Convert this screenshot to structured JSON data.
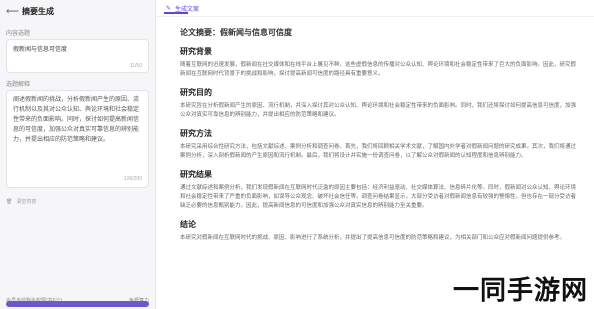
{
  "left": {
    "header_title": "摘要生成",
    "topic_label": "内容选题",
    "topic_value": "假新闻与信息可信度",
    "topic_counter": "11/50",
    "req_label": "选题解释",
    "req_text": "阐述假新闻的挑战，分析假新闻产生的原因、流行机制以及其对公众认知、舆论环境和社会稳定性带来的负面影响。同时，探讨如何提高新闻信息的可信度，加强公众对真实可靠信息的辨别能力，并提出相应的防范策略和建议。",
    "req_counter": "126/200",
    "req_action": "清空内容",
    "bottom_left": "会员当前剩余权限(共6个)",
    "bottom_right": "免费算力"
  },
  "right": {
    "tab_label": "生成文案",
    "title": "论文摘要：假新闻与信息可信度",
    "sections": [
      {
        "heading": "研究背景",
        "text": "随着互联网的迅速发展，假新闻在社交媒体和在线平台上屡见不鲜，这些虚假信息的传播对公众认知、舆论环境和社会稳定性带来了巨大的负面影响。因此，研究假新闻在互联网时代背景下的挑战和影响，探讨提高新闻可信度的路径具有重要意义。"
      },
      {
        "heading": "研究目的",
        "text": "本研究旨在分析假新闻产生的原因、流行机制，并深入探讨其对公众认知、舆论环境和社会稳定性带来的负面影响。同时，我们还将探讨如何提高信息可信度，加强公众对真实可靠信息的辨别能力，并提出相应的防范策略和建议。"
      },
      {
        "heading": "研究方法",
        "text": "本研究采用综合性研究方法，包括文献综述、案例分析和调查问卷。首先，我们将回顾相关学术文献，了解国内外学者对假新闻问题的研究成果。其次，我们将通过案例分析，深入剖析假新闻的产生原因和流行机制。最后，我们将设计并实施一份调查问卷，以了解公众对假新闻的认知程度和信息辨别能力。"
      },
      {
        "heading": "研究结果",
        "text": "通过文献综述和案例分析，我们发现假新闻在互联网时代泛滥的原因主要包括：经济利益驱动、社交媒体算法、信息碎片化等。同时，假新闻对公众认知、舆论环境和社会稳定性带来了严重的负面影响，如误导公众观念、破坏社会信任等。调查问卷结果显示，大部分受访者对假新闻信息有较强的警惕性，但也存在一部分受访者缺乏必要的信息甄别能力。因此，提高新闻信息的可信度和加强公众对真实信息的辨别能力至关重要。"
      },
      {
        "heading": "结论",
        "text": "本研究对假新闻在互联网时代的挑战、原因、影响进行了系统分析，并提出了提高信息可信度的防范策略和建议，为相关部门和公众应对假新闻问题提供参考。"
      }
    ]
  },
  "watermark": {
    "text": "一同手游网",
    "accent": "#f2a100"
  }
}
